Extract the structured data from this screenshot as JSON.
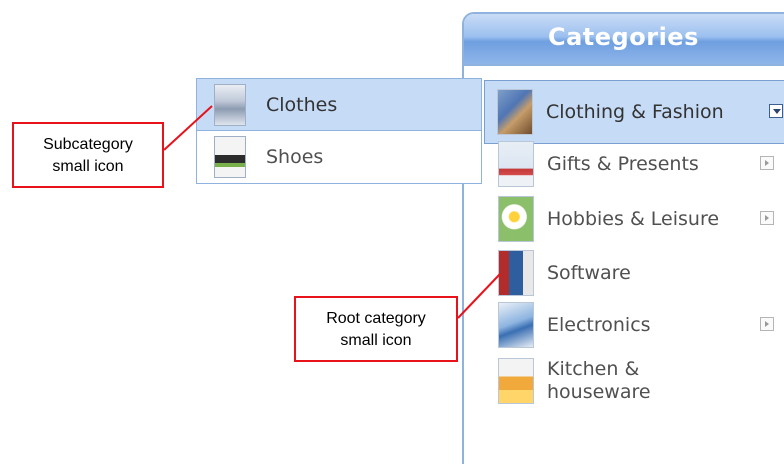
{
  "categories_panel": {
    "title": "Categories",
    "items": [
      {
        "label": "Clothing & Fashion",
        "icon": "fashion-thumbnail-icon",
        "has_submenu": true,
        "expanded": true
      },
      {
        "label": "Gifts & Presents",
        "icon": "gifts-thumbnail-icon",
        "has_submenu": true
      },
      {
        "label": "Hobbies & Leisure",
        "icon": "hobbies-thumbnail-icon",
        "has_submenu": true
      },
      {
        "label": "Software",
        "icon": "software-thumbnail-icon",
        "has_submenu": false
      },
      {
        "label": "Electronics",
        "icon": "electronics-thumbnail-icon",
        "has_submenu": true
      },
      {
        "label": "Kitchen & houseware",
        "icon": "kitchen-thumbnail-icon",
        "has_submenu": false
      }
    ]
  },
  "subcategory_panel": {
    "items": [
      {
        "label": "Clothes",
        "icon": "clothes-thumbnail-icon"
      },
      {
        "label": "Shoes",
        "icon": "shoes-thumbnail-icon"
      }
    ]
  },
  "callouts": {
    "subcategory_line1": "Subcategory",
    "subcategory_line2": "small icon",
    "root_line1": "Root category",
    "root_line2": "small icon"
  },
  "colors": {
    "callout_border": "#e8121b",
    "panel_border": "#8fb3de",
    "highlight": "#c6dbf6"
  }
}
